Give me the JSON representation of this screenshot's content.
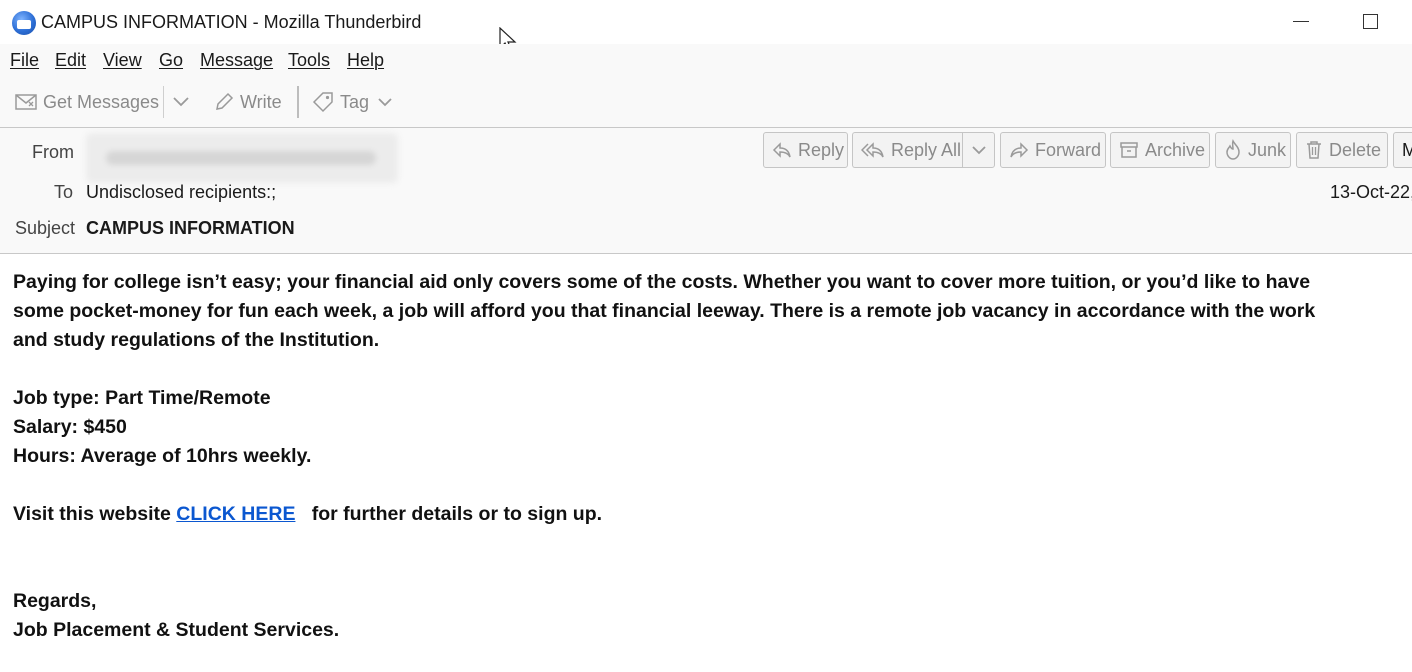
{
  "window": {
    "title": "CAMPUS INFORMATION - Mozilla Thunderbird"
  },
  "menubar": {
    "items": [
      "File",
      "Edit",
      "View",
      "Go",
      "Message",
      "Tools",
      "Help"
    ]
  },
  "toolbar": {
    "get_messages": "Get Messages",
    "write": "Write",
    "tag": "Tag"
  },
  "header": {
    "from_label": "From",
    "to_label": "To",
    "subject_label": "Subject",
    "to_value": "Undisclosed recipients:;",
    "subject_value": "CAMPUS INFORMATION",
    "date_value": "13-Oct-22,",
    "actions": {
      "reply": "Reply",
      "reply_all": "Reply All",
      "forward": "Forward",
      "archive": "Archive",
      "junk": "Junk",
      "delete": "Delete",
      "more": "M"
    }
  },
  "message": {
    "intro_lines": [
      "Paying for college isn’t easy; your financial aid only covers some of the costs. Whether you want to cover more tuition, or you’d like to have",
      "some pocket-money for fun each week, a job will afford you that financial leeway. There is a remote job vacancy in accordance with the work",
      "and study regulations of the Institution."
    ],
    "job_type": "Job type: Part Time/Remote",
    "salary": "Salary: $450",
    "hours": "Hours: Average of 10hrs weekly.",
    "visit_prefix": "Visit this website ",
    "link_text": "CLICK HERE",
    "visit_suffix": "   for further details or to sign up.",
    "regards": "Regards,",
    "signature": "Job Placement & Student Services."
  },
  "colors": {
    "link": "#0b57d0",
    "toolbar_bg": "#f9f9f9",
    "disabled_text": "#8a8a8a"
  }
}
